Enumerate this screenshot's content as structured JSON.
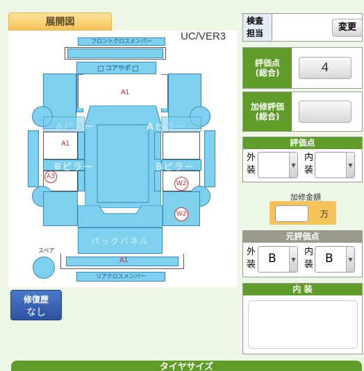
{
  "tab_title": "展開図",
  "version": "UC/VER3",
  "diagram": {
    "front_cross_member": "フロントクロスメンバー",
    "core_support": "コアサポ",
    "a_pillar_left": "Aピラー",
    "a_pillar_right": "Aピラー",
    "b_pillar_left": "Bピラー",
    "b_pillar_right": "Bピラー",
    "back_panel": "バックパネル",
    "rear_cross_member": "リアクロスメンバー",
    "spare": "スペア",
    "marks": {
      "a1_hood": "A1",
      "a1_door": "A1",
      "a3": "A3",
      "w2_upper": "W2",
      "w2_lower": "W2",
      "a1_rear": "A1"
    }
  },
  "repair_history": {
    "label": "修復歴",
    "value": "なし"
  },
  "inspector": {
    "label_line1": "検査",
    "label_line2": "担当",
    "change_button": "変更"
  },
  "overall_score": {
    "label_line1": "評価点",
    "label_line2": "(総合)",
    "value": "4"
  },
  "repair_score": {
    "label_line1": "加修評価",
    "label_line2": "(総合)",
    "value": ""
  },
  "score": {
    "title": "評価点",
    "exterior_label_1": "外",
    "exterior_label_2": "装",
    "interior_label_1": "内",
    "interior_label_2": "装",
    "exterior_value": "",
    "interior_value": ""
  },
  "repair_amount": {
    "label": "加修金額",
    "unit": "万",
    "value": ""
  },
  "original_score": {
    "title": "元評価点",
    "exterior_label_1": "外",
    "exterior_label_2": "装",
    "interior_label_1": "内",
    "interior_label_2": "装",
    "exterior_value": "B",
    "interior_value": "B"
  },
  "interior_notes": {
    "title": "内 装",
    "value": ""
  },
  "tire_size": {
    "title": "タイヤサイズ"
  },
  "colors": {
    "green": "#5f9c2a",
    "blue": "#7dd0ee",
    "orange": "#f4c35a",
    "navy": "#2f59a8"
  }
}
